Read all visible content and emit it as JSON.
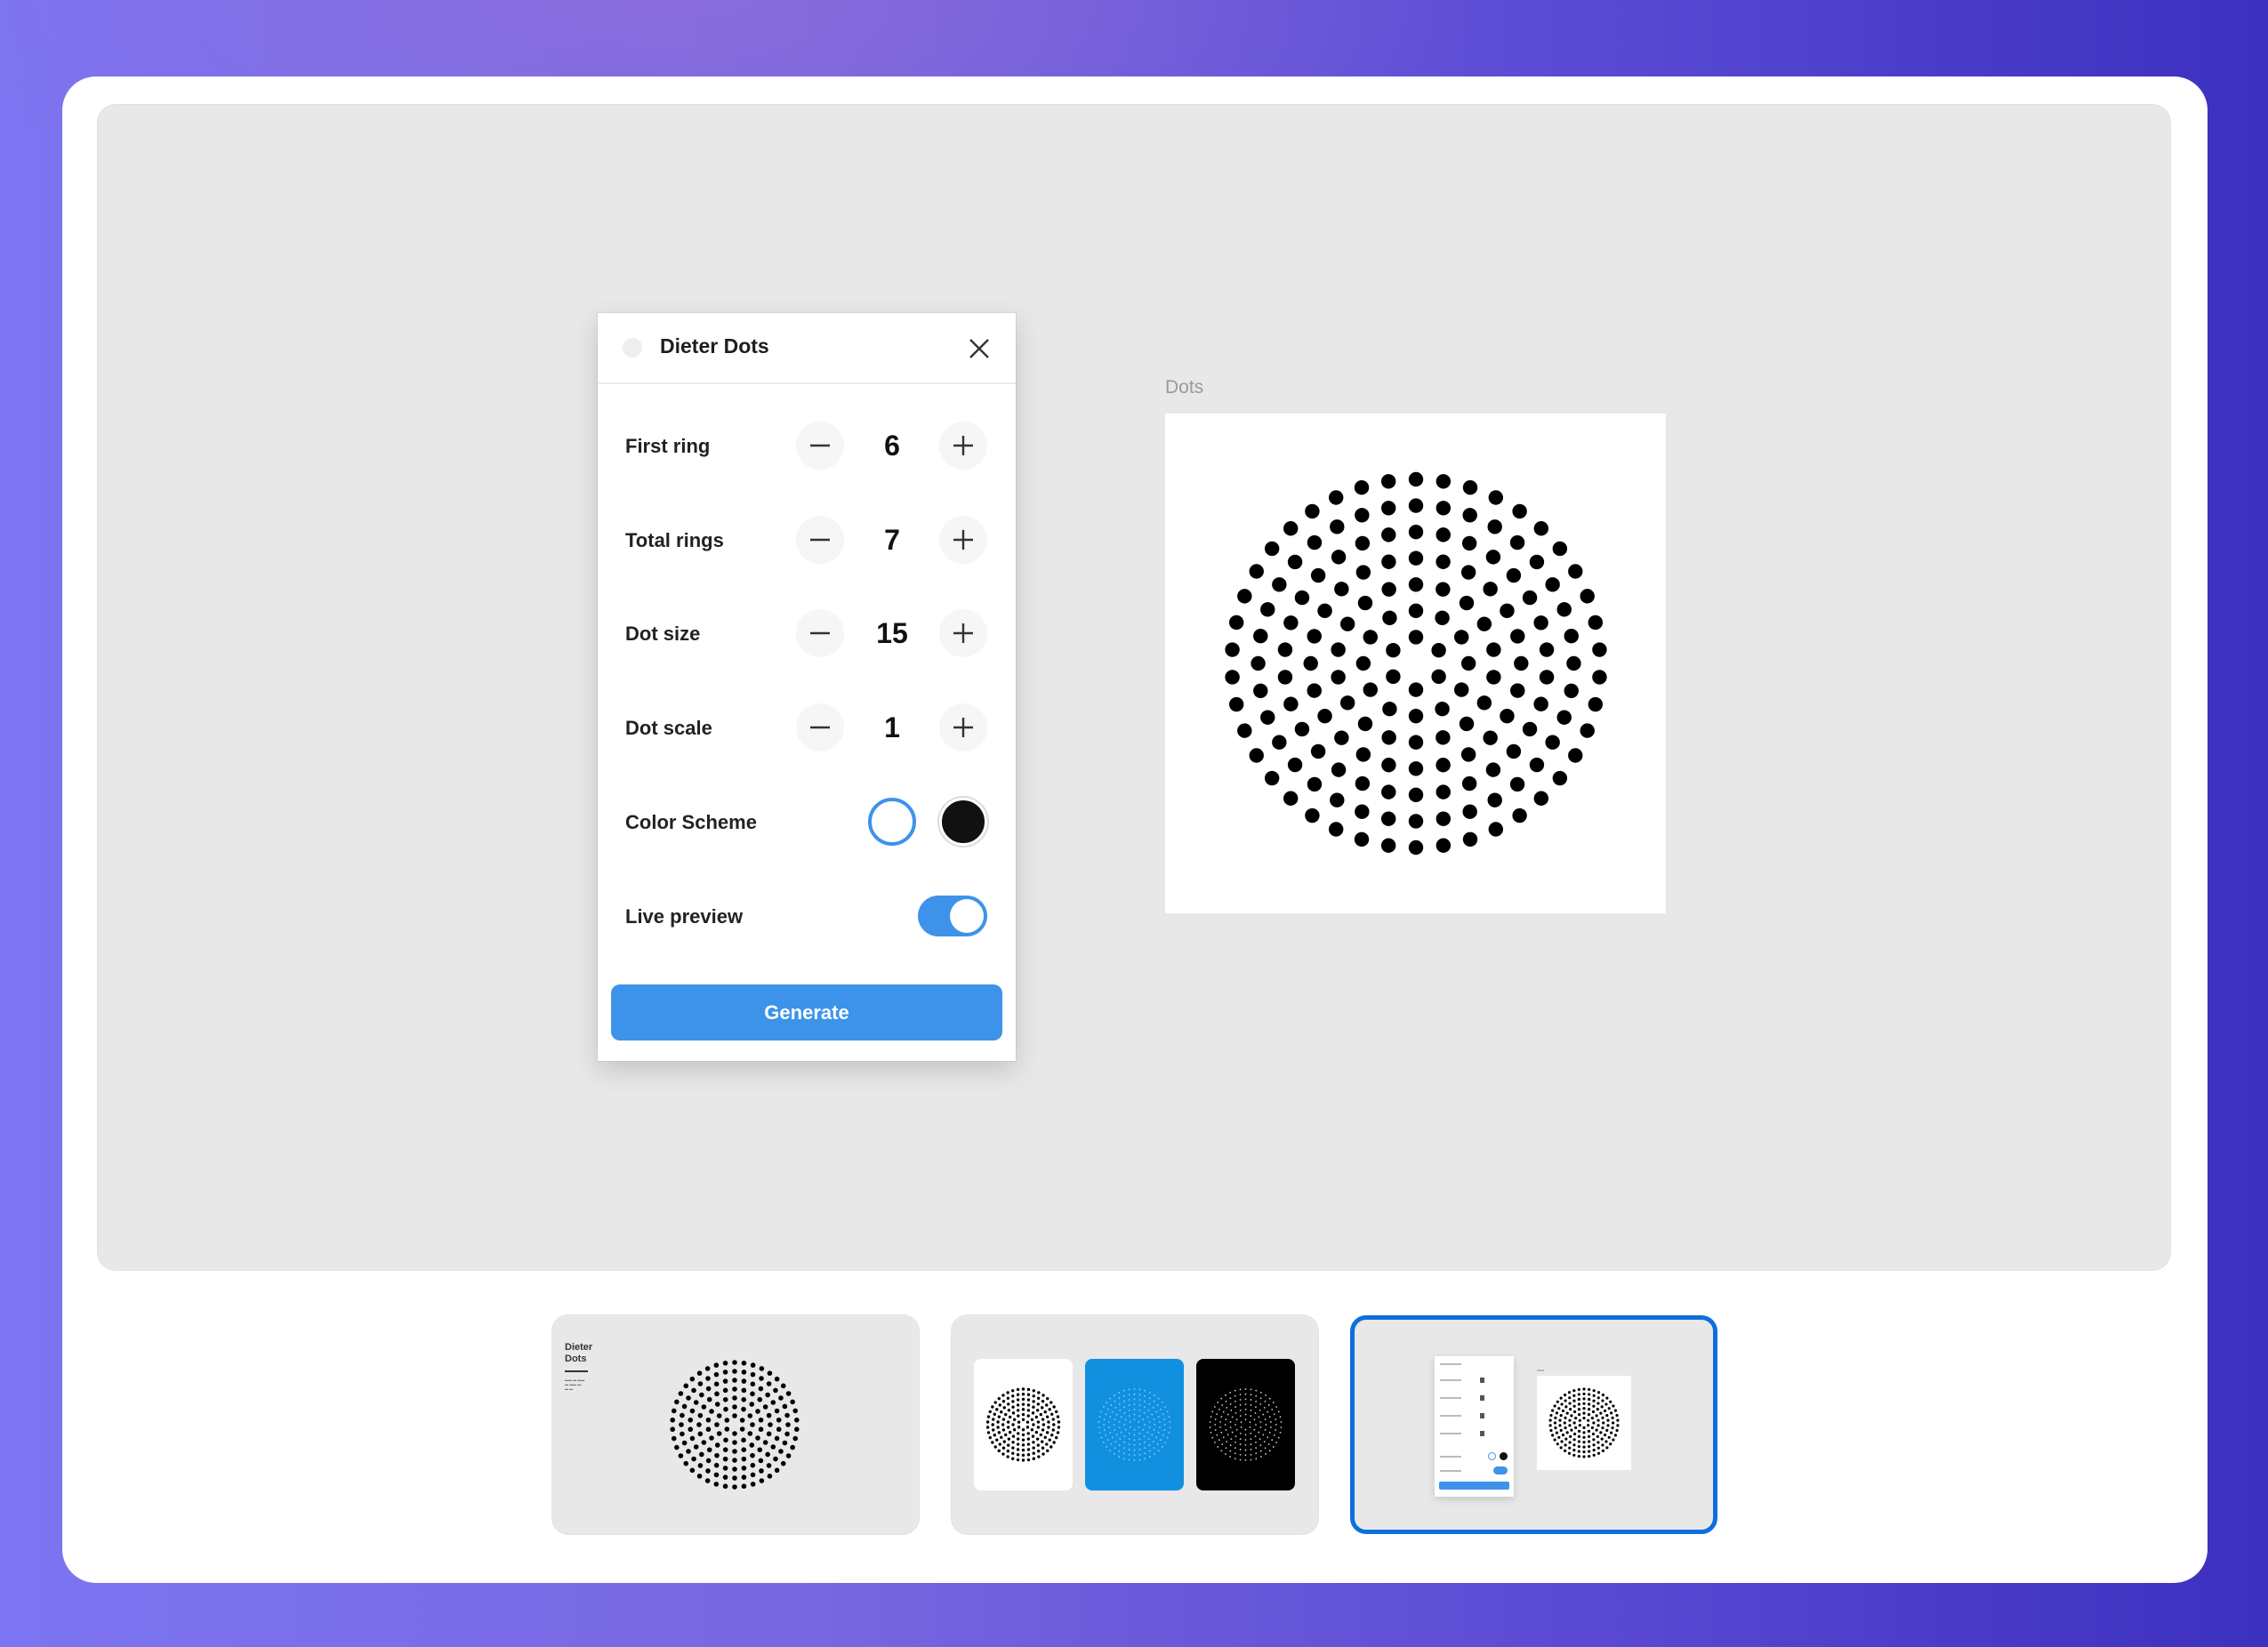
{
  "colors": {
    "accent": "#3d93ea",
    "selected_border": "#0d6fde",
    "canvas_bg": "#e8e8e8",
    "dot": "#000000"
  },
  "plugin": {
    "icon": "plugin-icon",
    "title": "Dieter Dots",
    "close_icon": "close-icon",
    "controls": [
      {
        "label": "First ring",
        "value": "6",
        "minus_icon": "minus-icon",
        "plus_icon": "plus-icon"
      },
      {
        "label": "Total rings",
        "value": "7",
        "minus_icon": "minus-icon",
        "plus_icon": "plus-icon"
      },
      {
        "label": "Dot size",
        "value": "15",
        "minus_icon": "minus-icon",
        "plus_icon": "plus-icon"
      },
      {
        "label": "Dot scale",
        "value": "1",
        "minus_icon": "minus-icon",
        "plus_icon": "plus-icon"
      }
    ],
    "color_scheme": {
      "label": "Color Scheme",
      "options": [
        {
          "name": "white",
          "color": "#ffffff",
          "selected": true
        },
        {
          "name": "black",
          "color": "#111111",
          "selected": false
        }
      ]
    },
    "live_preview": {
      "label": "Live preview",
      "on": true
    },
    "generate_label": "Generate"
  },
  "preview": {
    "frame_label": "Dots",
    "pattern": {
      "first_ring": 6,
      "total_rings": 7,
      "dot_size": 15,
      "dot_scale": 1,
      "dot_color": "#000000",
      "background": "#ffffff"
    }
  },
  "thumbnails": [
    {
      "name": "cover",
      "title": "Dieter Dots",
      "selected": false
    },
    {
      "name": "color-variants",
      "variants": [
        {
          "bg": "#ffffff",
          "dot": "#000000"
        },
        {
          "bg": "#1190e0",
          "dot": "#7fd0ff"
        },
        {
          "bg": "#000000",
          "dot": "#cccccc"
        }
      ],
      "selected": false
    },
    {
      "name": "plugin-ui",
      "selected": true
    }
  ]
}
